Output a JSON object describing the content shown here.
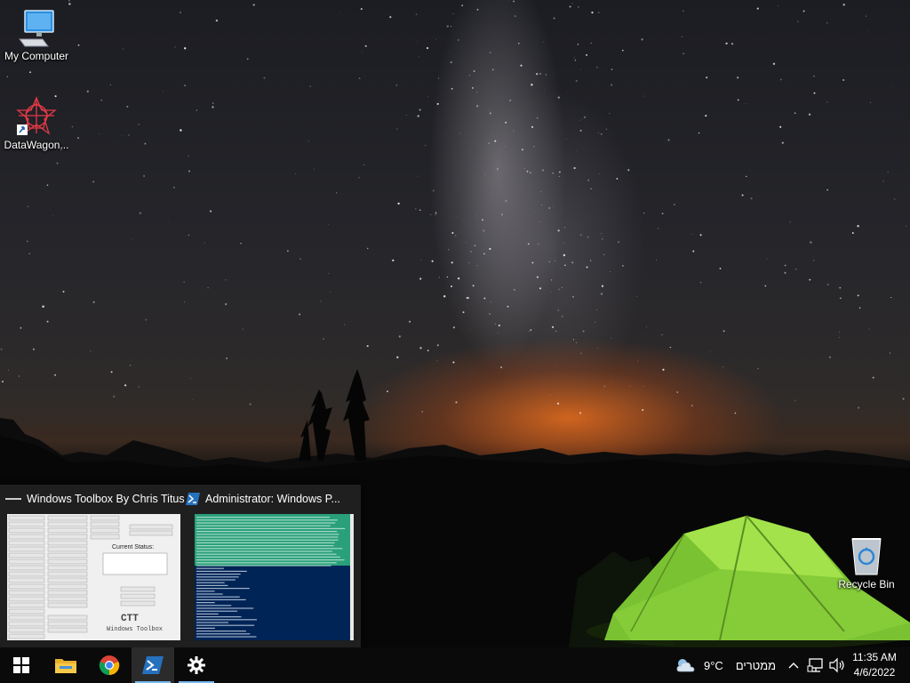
{
  "desktop": {
    "icons": [
      {
        "label": "My Computer"
      },
      {
        "label": "DataWagon..."
      },
      {
        "label": "Recycle Bin"
      }
    ]
  },
  "thumbnails": [
    {
      "title": "Windows Toolbox By Chris Titus",
      "preview": {
        "heading": "Current Status:",
        "logo": "CTT",
        "logo_sub": "Windows Toolbox"
      }
    },
    {
      "title": "Administrator: Windows P..."
    }
  ],
  "taskbar": {
    "apps": [
      "start",
      "file-explorer",
      "chrome",
      "powershell",
      "settings"
    ],
    "weather": {
      "temp": "9°C",
      "condition": "ממטרים",
      "icon": "partly-cloudy-icon"
    },
    "clock": {
      "time": "11:35 AM",
      "date": "4/6/2022"
    }
  },
  "colors": {
    "taskbar": "#0a0a0a",
    "running_indicator": "#76b9ed",
    "tent": "#8fd23a",
    "powershell_bg": "#012456"
  }
}
